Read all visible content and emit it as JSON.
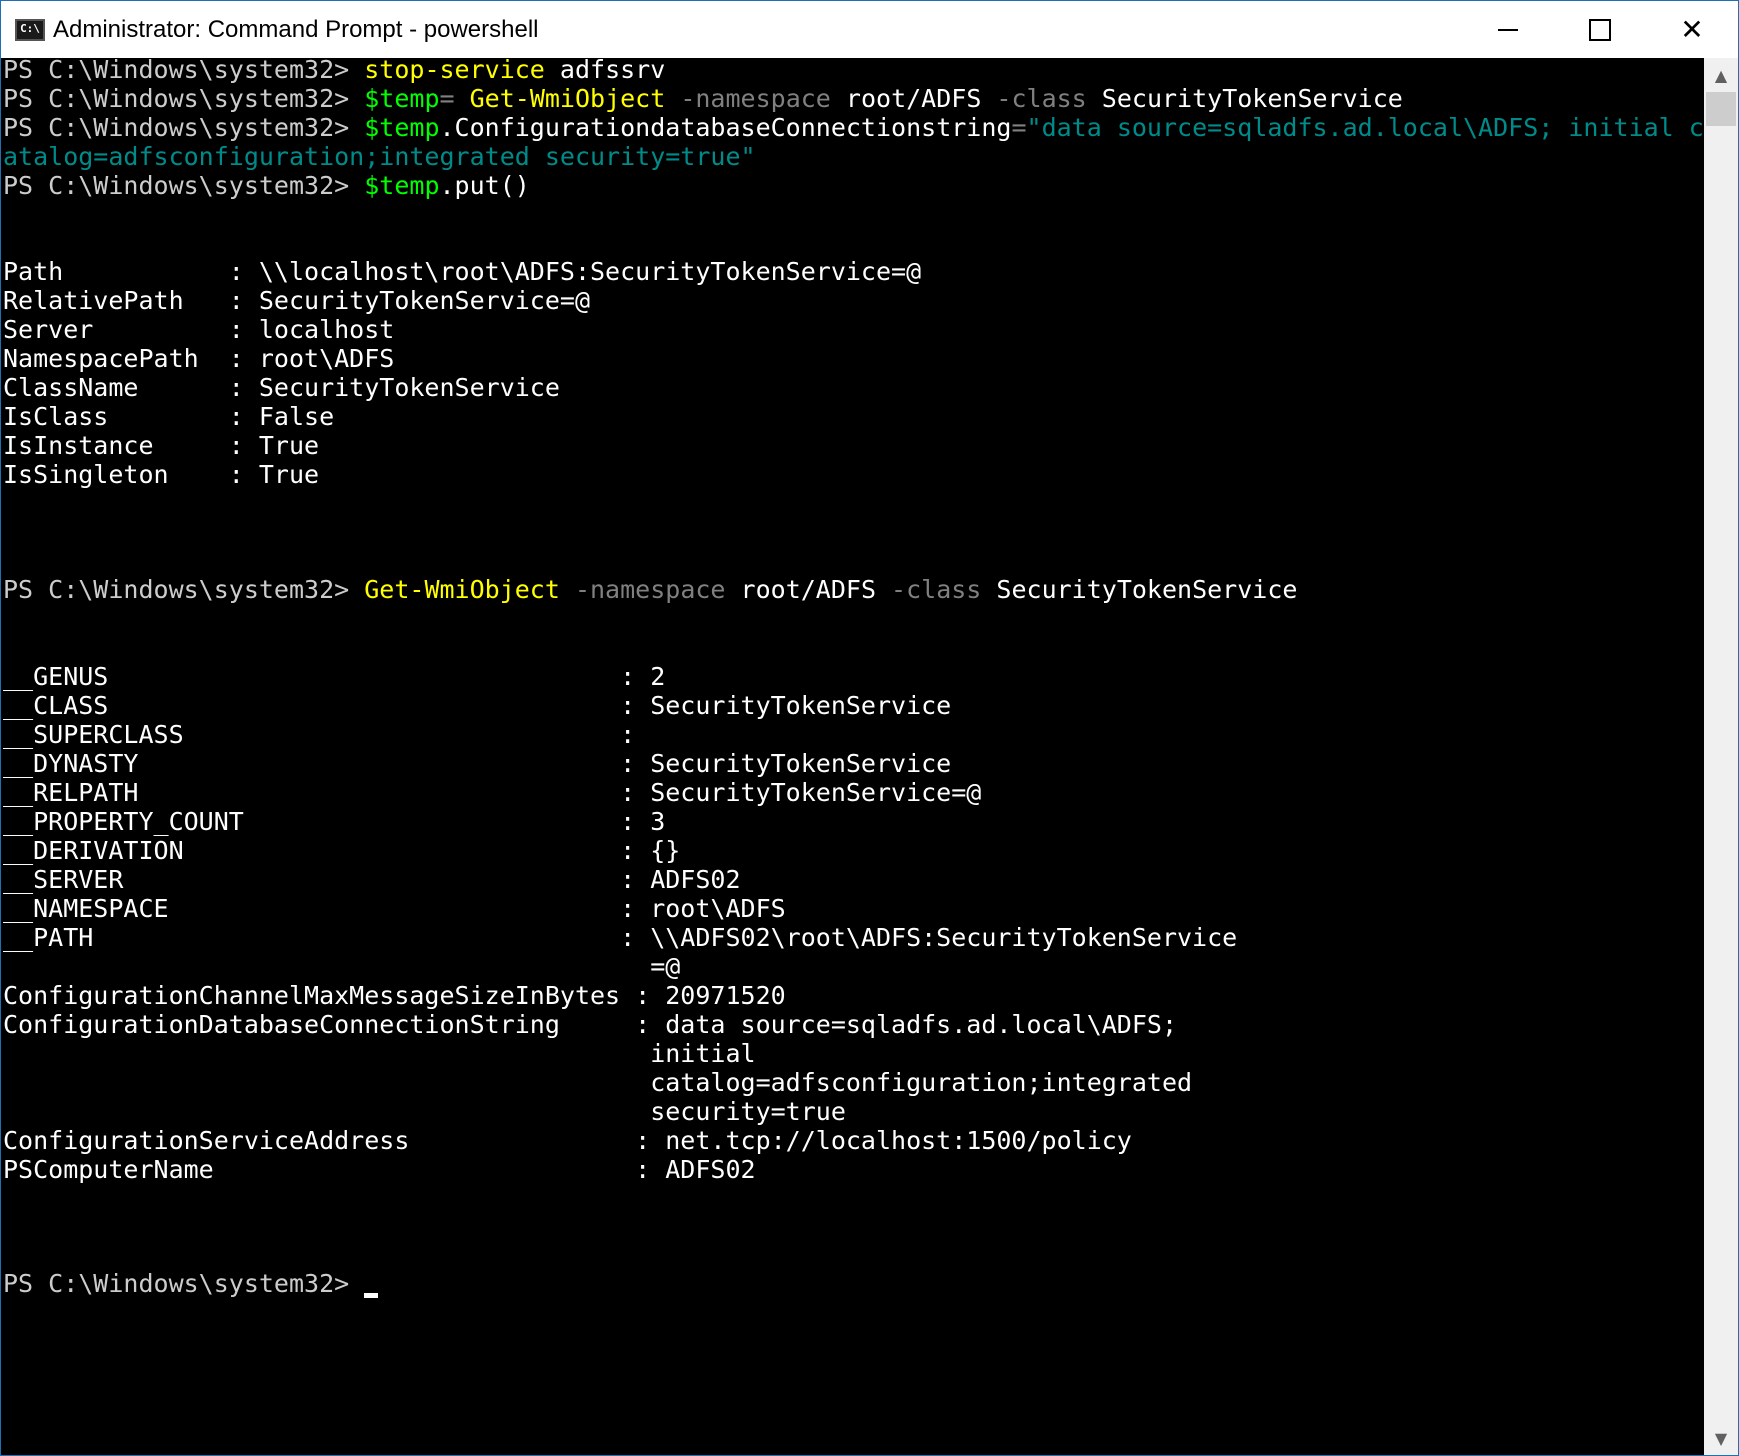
{
  "window": {
    "icon_text": "C:\\",
    "title": "Administrator: Command Prompt - powershell",
    "minimize_icon": "minimize-icon",
    "maximize_icon": "maximize-icon",
    "close_glyph": "✕"
  },
  "scrollbar": {
    "up_arrow": "▲",
    "down_arrow": "▼"
  },
  "console": {
    "prompt": "PS C:\\Windows\\system32> ",
    "line1": {
      "cmd": "stop-service",
      "arg": " adfssrv"
    },
    "line2": {
      "var": "$temp",
      "eq": "= ",
      "cmd": "Get-WmiObject",
      "p1": " -namespace",
      "a1": " root/ADFS",
      "p2": " -class",
      "a2": " SecurityTokenService"
    },
    "line3": {
      "var": "$temp",
      "member": ".ConfigurationdatabaseConnectionstring",
      "eq": "=",
      "str_part1": "\"data source=sqladfs.ad.local\\ADFS; initial c"
    },
    "line4": {
      "str_part2": "atalog=adfsconfiguration;integrated security=true\""
    },
    "line5": {
      "var": "$temp",
      "member": ".put()"
    },
    "put_output": [
      "Path           : \\\\localhost\\root\\ADFS:SecurityTokenService=@",
      "RelativePath   : SecurityTokenService=@",
      "Server         : localhost",
      "NamespacePath  : root\\ADFS",
      "ClassName      : SecurityTokenService",
      "IsClass        : False",
      "IsInstance     : True",
      "IsSingleton    : True"
    ],
    "line6": {
      "cmd": "Get-WmiObject",
      "p1": " -namespace",
      "a1": " root/ADFS",
      "p2": " -class",
      "a2": " SecurityTokenService"
    },
    "get_output": [
      "__GENUS                                  : 2",
      "__CLASS                                  : SecurityTokenService",
      "__SUPERCLASS                             :",
      "__DYNASTY                                : SecurityTokenService",
      "__RELPATH                                : SecurityTokenService=@",
      "__PROPERTY_COUNT                         : 3",
      "__DERIVATION                             : {}",
      "__SERVER                                 : ADFS02",
      "__NAMESPACE                              : root\\ADFS",
      "__PATH                                   : \\\\ADFS02\\root\\ADFS:SecurityTokenService",
      "                                           =@",
      "ConfigurationChannelMaxMessageSizeInBytes : 20971520",
      "ConfigurationDatabaseConnectionString     : data source=sqladfs.ad.local\\ADFS;",
      "                                           initial",
      "                                           catalog=adfsconfiguration;integrated",
      "                                           security=true",
      "ConfigurationServiceAddress               : net.tcp://localhost:1500/policy",
      "PSComputerName                            : ADFS02"
    ]
  }
}
